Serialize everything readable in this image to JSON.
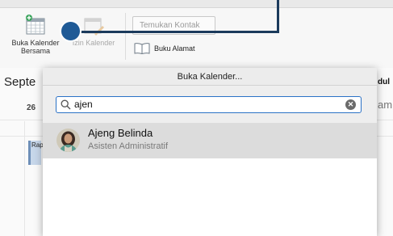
{
  "ribbon": {
    "open_shared_calendar": {
      "label_line1": "Buka Kalender",
      "label_line2": "Bersama",
      "icon": "calendar-add-icon"
    },
    "calendar_permissions": {
      "label": "Izin Kalender",
      "icon": "calendar-permissions-icon",
      "enabled": false
    },
    "search_contacts": {
      "placeholder": "Temukan Kontak"
    },
    "address_book": {
      "label": "Buku Alamat",
      "icon": "address-book-icon"
    }
  },
  "background_calendar": {
    "month_partial": "Septe",
    "day_number": "26",
    "right_label_1": "dul",
    "right_label_2": "am",
    "event_partial": "Rap"
  },
  "dialog": {
    "title": "Buka Kalender...",
    "search": {
      "value": "ajen",
      "icon": "search-icon",
      "clear_icon": "clear-icon"
    },
    "results": [
      {
        "name": "Ajeng Belinda",
        "title": "Asisten Administratif",
        "avatar": "person-avatar"
      }
    ]
  },
  "colors": {
    "accent": "#2b72c6",
    "callout": "#1b3a5c",
    "callout_dot": "#1f5a96",
    "selected_row": "#dcdcdc"
  }
}
